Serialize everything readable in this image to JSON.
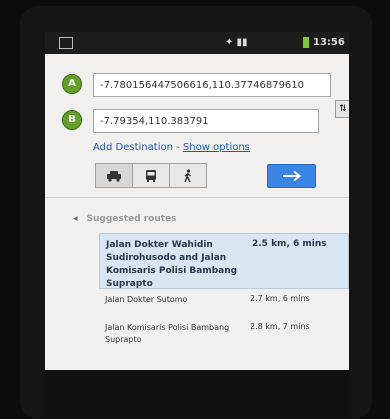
{
  "status_bar": {
    "time": "13:56"
  },
  "origin": {
    "marker": "A",
    "value": "-7.780156447506616,110.37746879610"
  },
  "destination": {
    "marker": "B",
    "value": "-7.79354,110.383791"
  },
  "swap_label": "⇅",
  "links": {
    "add_destination": "Add Destination",
    "separator": " - ",
    "show_options": "Show options"
  },
  "travel_modes": [
    {
      "name": "car",
      "active": true
    },
    {
      "name": "transit",
      "active": false
    },
    {
      "name": "walk",
      "active": false
    }
  ],
  "go_button": {
    "icon": "arrow-right"
  },
  "suggested_routes": {
    "heading": "Suggested routes",
    "routes": [
      {
        "name": "Jalan Dokter Wahidin Sudirohusodo and Jalan Komisaris Polisi Bambang Suprapto",
        "info": "2.5 km, 6 mins",
        "selected": true
      },
      {
        "name": "Jalan Dokter Sutomo",
        "info": "2.7 km, 6 mins",
        "selected": false
      },
      {
        "name": "Jalan Komisaris Polisi Bambang Suprapto",
        "info": "2.8 km, 7 mins",
        "selected": false
      }
    ]
  },
  "colors": {
    "accent": "#3a84e4",
    "marker": "#62a02a",
    "selected_route": "#d9e6f2",
    "link": "#2255bb"
  }
}
